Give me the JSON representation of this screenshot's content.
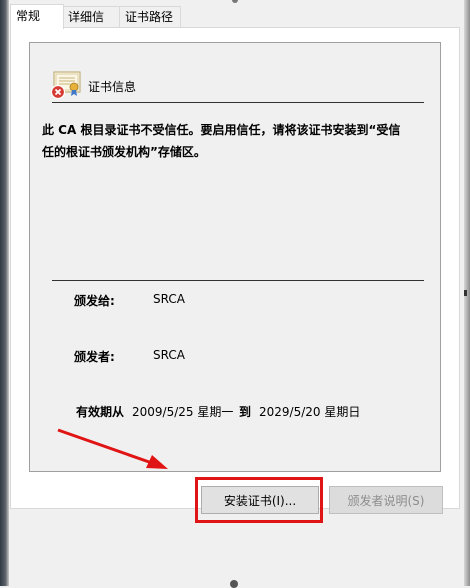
{
  "tabs": [
    {
      "label": "常规",
      "active": true
    },
    {
      "label": "详细信息",
      "active": false
    },
    {
      "label": "证书路径",
      "active": false
    }
  ],
  "certificate": {
    "section_title": "证书信息",
    "warning_line1": "此 CA 根目录证书不受信任。要启用信任，请将该证书安装到“受信",
    "warning_line2": "任的根证书颁发机构”存储区。",
    "issued_to_label": "颁发给:",
    "issued_to_value": "SRCA",
    "issued_by_label": "颁发者:",
    "issued_by_value": "SRCA",
    "validity_label": "有效期从",
    "valid_from": "2009/5/25 星期一",
    "to_word": "到",
    "valid_to": "2029/5/20 星期日"
  },
  "buttons": {
    "install_label": "安装证书(I)...",
    "issuer_statement_label": "颁发者说明(S)"
  },
  "colors": {
    "annotation_red": "#e01414",
    "panel_bg": "#f0f0f0"
  },
  "icons": [
    "certificate-error-icon",
    "red-arrow-annotation"
  ]
}
